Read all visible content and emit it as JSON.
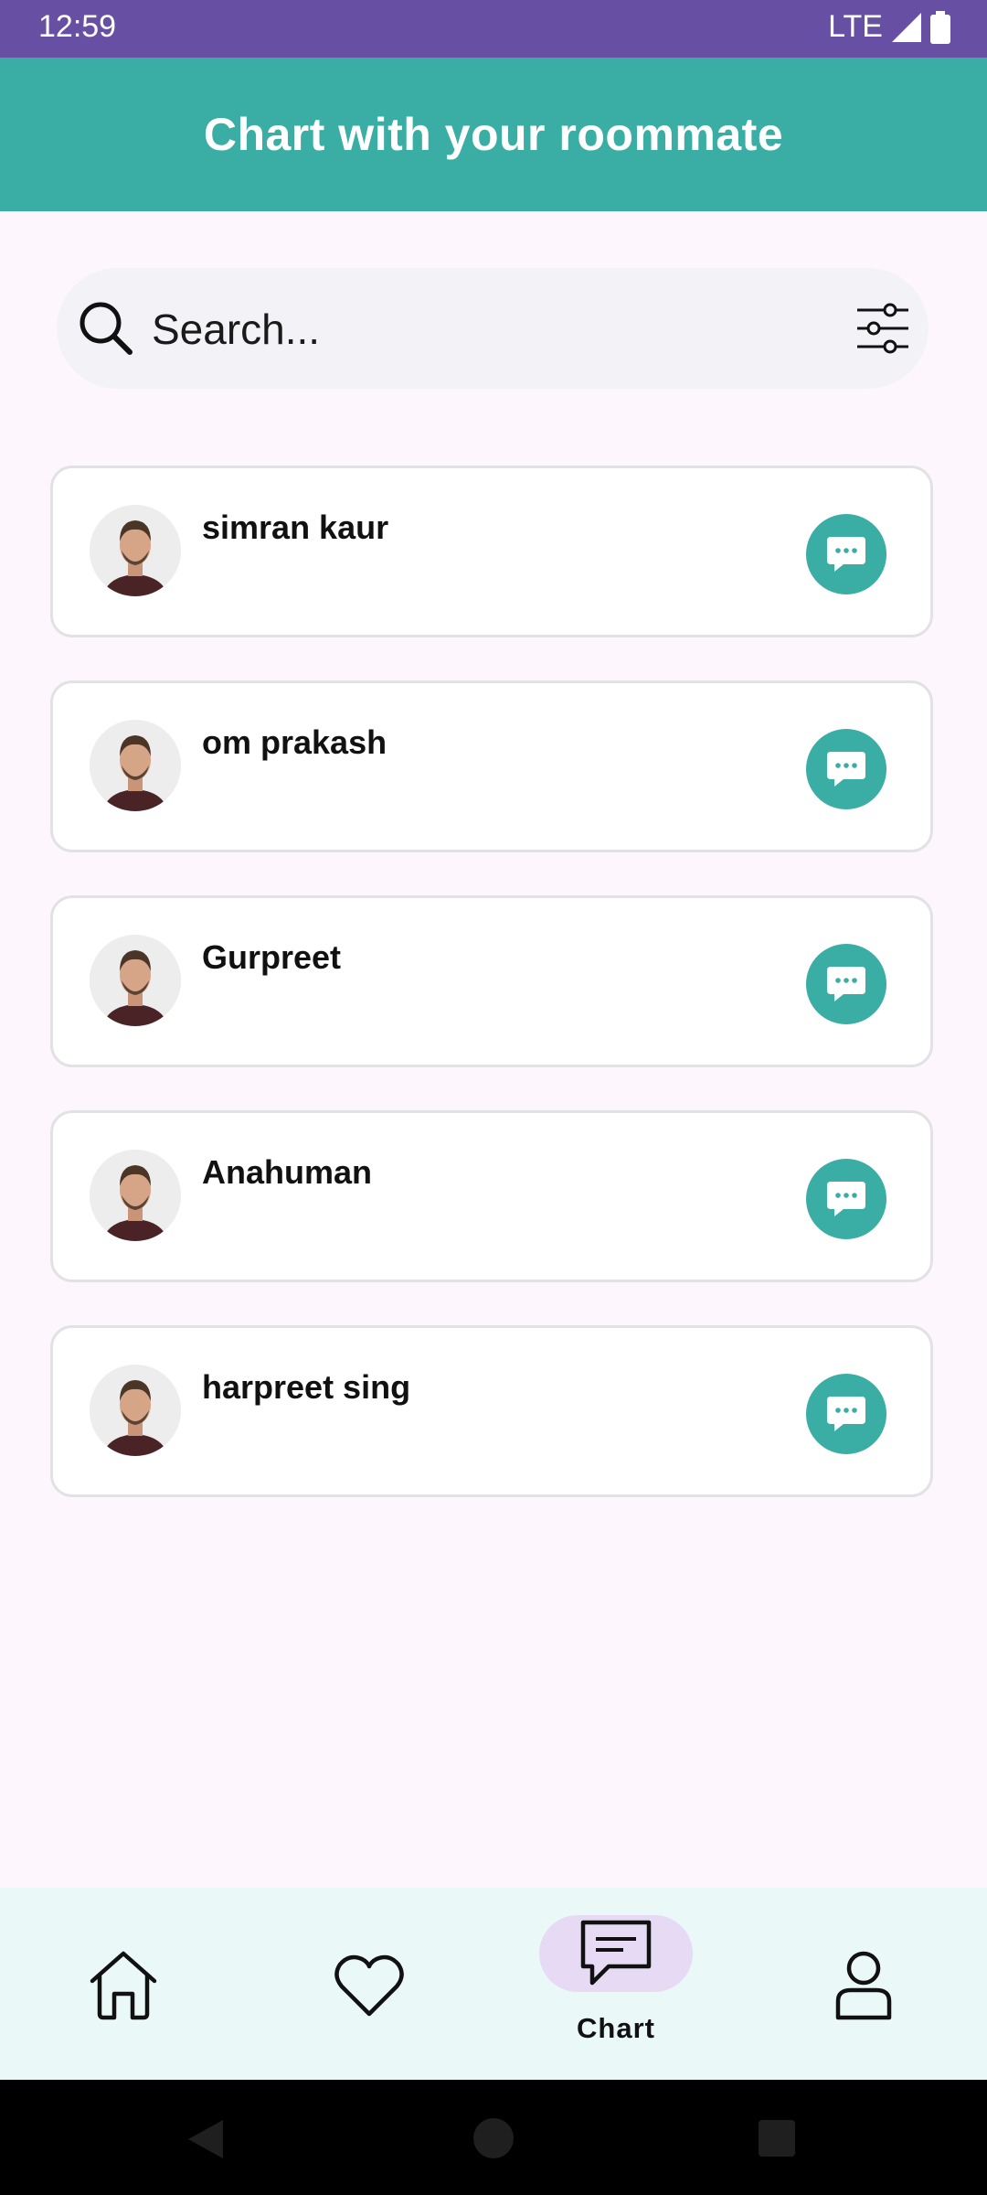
{
  "status_bar": {
    "time": "12:59",
    "network": "LTE"
  },
  "header": {
    "title": "Chart with your roommate"
  },
  "search": {
    "placeholder": "Search..."
  },
  "colors": {
    "primary": "#3AADA5",
    "status_bar": "#6750A4",
    "selected_pill": "#E6DAF4"
  },
  "contacts": [
    {
      "name": "simran kaur"
    },
    {
      "name": "om prakash"
    },
    {
      "name": "Gurpreet"
    },
    {
      "name": "Anahuman"
    },
    {
      "name": "harpreet sing"
    }
  ],
  "bottom_nav": {
    "items": [
      {
        "icon": "home-icon",
        "label": ""
      },
      {
        "icon": "heart-icon",
        "label": ""
      },
      {
        "icon": "chat-icon",
        "label": "Chart",
        "selected": true
      },
      {
        "icon": "profile-icon",
        "label": ""
      }
    ]
  }
}
